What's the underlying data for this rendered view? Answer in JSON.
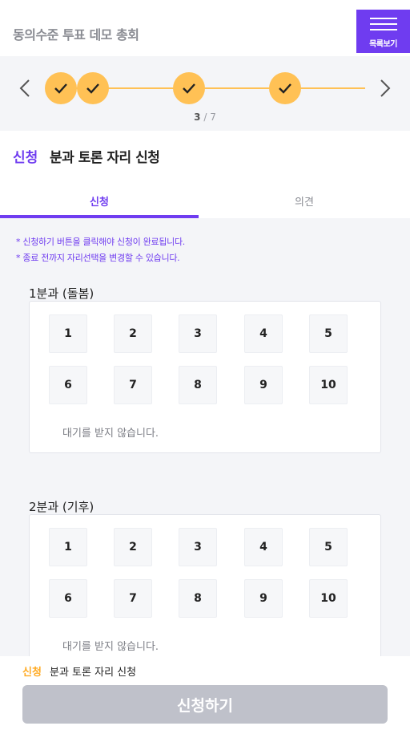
{
  "header": {
    "title": "동의수준 투표 데모 총회",
    "menu_label": "목록보기"
  },
  "progress": {
    "current": "3",
    "separator": " / ",
    "total": "7",
    "completed_steps": 4,
    "accent": "#ffc155"
  },
  "section": {
    "tag": "신청",
    "title": "분과 토론 자리 신청"
  },
  "tabs": [
    {
      "label": "신청",
      "active": true
    },
    {
      "label": "의견",
      "active": false
    }
  ],
  "notices": [
    "* 신청하기 버튼을 클릭해야 신청이 완료됩니다.",
    "* 종료 전까지 자리선택을 변경할 수 있습니다."
  ],
  "groups": [
    {
      "title": "1분과 (돌봄)",
      "seats": [
        "1",
        "2",
        "3",
        "4",
        "5",
        "6",
        "7",
        "8",
        "9",
        "10"
      ],
      "note": "대기를 받지 않습니다."
    },
    {
      "title": "2분과 (기후)",
      "seats": [
        "1",
        "2",
        "3",
        "4",
        "5",
        "6",
        "7",
        "8",
        "9",
        "10"
      ],
      "note": "대기를 받지 않습니다."
    }
  ],
  "bottom": {
    "tag": "신청",
    "text": "분과 토론 자리 신청",
    "button": "신청하기"
  },
  "colors": {
    "primary": "#6f3cf0",
    "orange": "#ffaa22",
    "disabled": "#bfc1ca"
  }
}
